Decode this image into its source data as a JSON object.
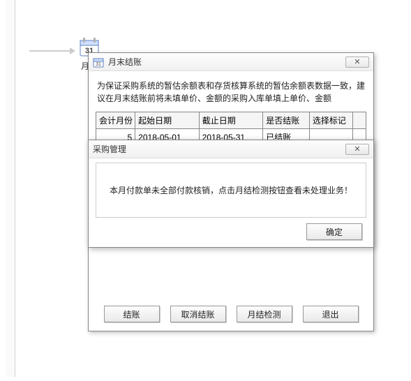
{
  "desktop": {
    "icon_label": "月末"
  },
  "main_dialog": {
    "title": "月末结账",
    "notice": "为保证采购系统的暂估余额表和存货核算系统的暂估余额表数据一致，建议在月末结账前将未填单价、金额的采购入库单填上单价、金额",
    "columns": [
      "会计月份",
      "起始日期",
      "截止日期",
      "是否结账",
      "选择标记",
      ""
    ],
    "rows": [
      {
        "period": "5",
        "start": "2018-05-01",
        "end": "2018-05-31",
        "status": "已结账",
        "mark": ""
      },
      {
        "period": " ",
        "start": " ",
        "end": " ",
        "status": " ",
        "mark": " "
      }
    ],
    "buttons": {
      "close_book": "结账",
      "cancel_close": "取消结账",
      "check": "月结检测",
      "exit": "退出"
    }
  },
  "sub_dialog": {
    "title": "采购管理",
    "message": "本月付款单未全部付款核销，点击月结检测按钮查看未处理业务！",
    "ok": "确定"
  }
}
